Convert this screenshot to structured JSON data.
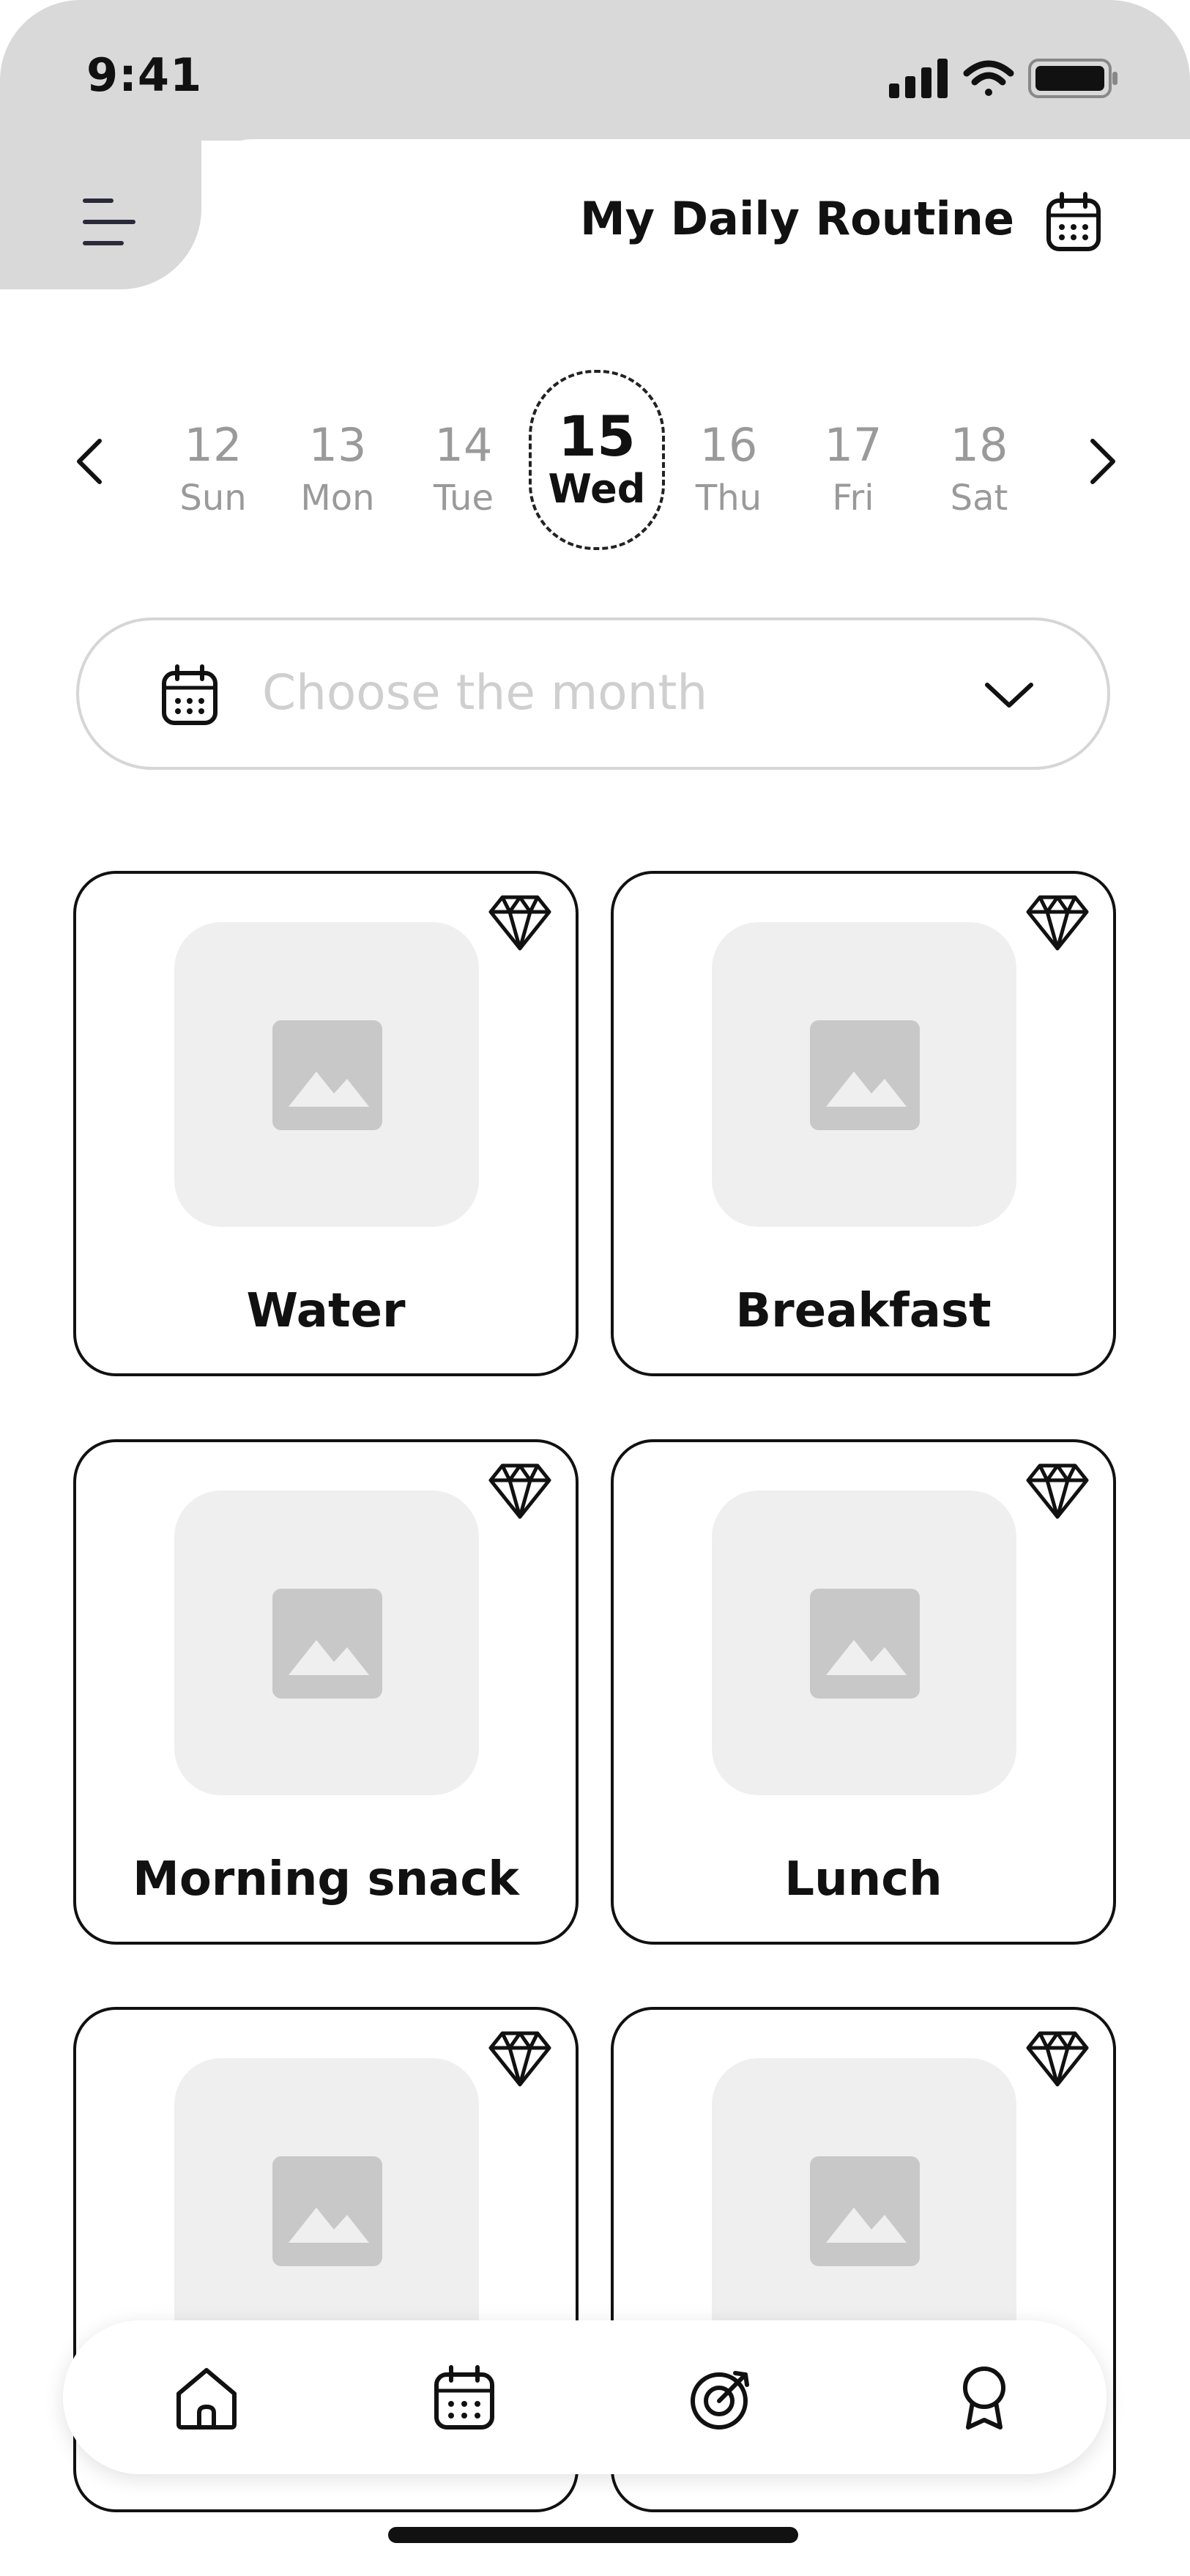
{
  "status_bar": {
    "time": "9:41"
  },
  "header": {
    "title": "My Daily Routine"
  },
  "date_strip": {
    "days": [
      {
        "num": "12",
        "weekday": "Sun"
      },
      {
        "num": "13",
        "weekday": "Mon"
      },
      {
        "num": "14",
        "weekday": "Tue"
      },
      {
        "num": "15",
        "weekday": "Wed"
      },
      {
        "num": "16",
        "weekday": "Thu"
      },
      {
        "num": "17",
        "weekday": "Fri"
      },
      {
        "num": "18",
        "weekday": "Sat"
      }
    ],
    "selected_index": 3
  },
  "month_select": {
    "placeholder": "Choose the month"
  },
  "cards": [
    {
      "label": "Water"
    },
    {
      "label": "Breakfast"
    },
    {
      "label": "Morning snack"
    },
    {
      "label": "Lunch"
    },
    {
      "label": ""
    },
    {
      "label": ""
    }
  ],
  "bottom_nav": {
    "items": [
      {
        "icon": "home-icon"
      },
      {
        "icon": "calendar-icon"
      },
      {
        "icon": "target-icon"
      },
      {
        "icon": "award-icon"
      }
    ]
  },
  "colors": {
    "chrome_gray": "#d9d9d9",
    "placeholder_gray": "#efefef",
    "image_icon_gray": "#c8c8c8",
    "text_dark": "#111111",
    "text_muted": "#9a9a9a"
  }
}
